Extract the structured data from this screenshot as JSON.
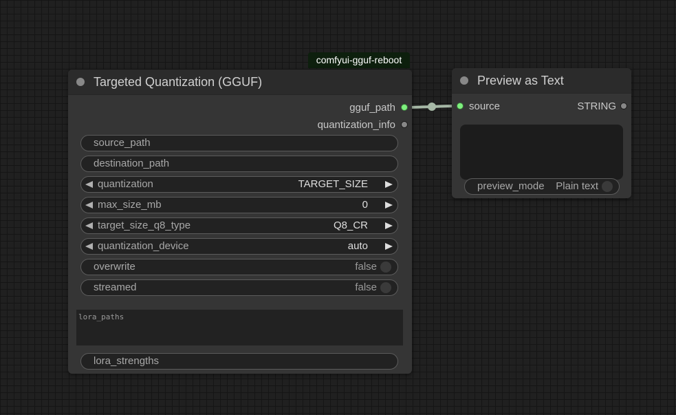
{
  "badge": {
    "text": "comfyui-gguf-reboot"
  },
  "quant_node": {
    "title": "Targeted Quantization (GGUF)",
    "outputs": [
      {
        "label": "gguf_path",
        "connected": true
      },
      {
        "label": "quantization_info",
        "connected": false
      }
    ],
    "text_widgets": {
      "source_path": "source_path",
      "destination_path": "destination_path",
      "lora_strengths": "lora_strengths"
    },
    "combos": [
      {
        "label": "quantization",
        "value": "TARGET_SIZE"
      },
      {
        "label": "max_size_mb",
        "value": "0"
      },
      {
        "label": "target_size_q8_type",
        "value": "Q8_CR"
      },
      {
        "label": "quantization_device",
        "value": "auto"
      }
    ],
    "toggles": [
      {
        "label": "overwrite",
        "value": "false"
      },
      {
        "label": "streamed",
        "value": "false"
      }
    ],
    "textarea": {
      "placeholder": "lora_paths"
    }
  },
  "preview_node": {
    "title": "Preview as Text",
    "input": {
      "label": "source",
      "connected": true
    },
    "output": {
      "label": "STRING",
      "connected": false
    },
    "preview_mode": {
      "label": "preview_mode",
      "value": "Plain text"
    }
  },
  "colors": {
    "canvas": "#202020",
    "node_body": "#353535",
    "node_header": "#2b2b2b",
    "link": "#a6b8a6",
    "connected_slot": "#7ef07e",
    "badge_bg": "#0d1f0d"
  }
}
